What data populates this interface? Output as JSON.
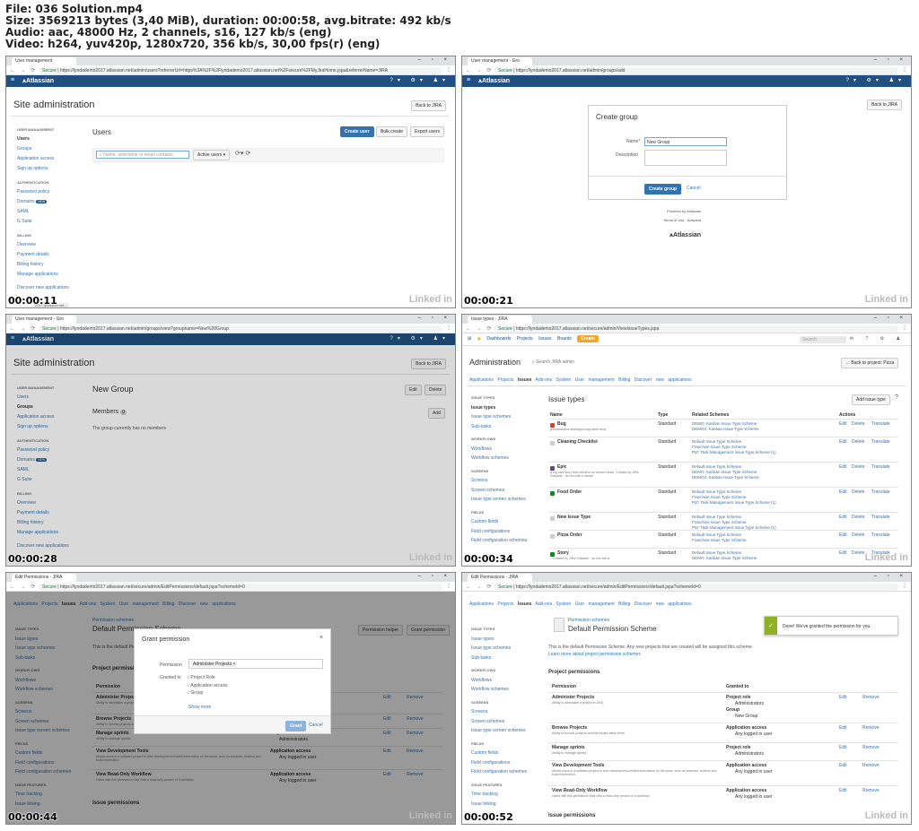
{
  "file_info": {
    "line1": "File: 036 Solution.mp4",
    "line2": "Size: 3569213 bytes (3,40 MiB), duration: 00:00:58, avg.bitrate: 492 kb/s",
    "line3": "Audio: aac, 48000 Hz, 2 channels, s16, 127 kb/s (eng)",
    "line4": "Video: h264, yuv420p, 1280x720, 356 kb/s, 30,00 fps(r) (eng)"
  },
  "watermark": "Linked in",
  "browser": {
    "secure": "Secure",
    "win_controls": "– ▫ ×"
  },
  "brand": "Atlassian",
  "frame1": {
    "tab": "User management",
    "timestamp": "00:00:11",
    "url": "https://lyndademo2017.atlassian.net/admin/users?referrerUrl=https%3A%2F%2Flyndademo2017.atlassian.net%2Fsecure%2FMyJiraHome.jspa&referrerName=JIRA",
    "title": "Site administration",
    "back": "Back to JIRA",
    "heading": "Users",
    "btn_create": "Create user",
    "btn_bulk": "Bulk create",
    "btn_export": "Export users",
    "search_ph": "Name, username or email contains",
    "filter": "Active users ▾",
    "status": "2017.atlassian.net..."
  },
  "sidebar": {
    "s1": "USER MANAGEMENT",
    "users": "Users",
    "groups": "Groups",
    "app_access": "Application access",
    "signup": "Sign up options",
    "s2": "AUTHENTICATION",
    "pw": "Password policy",
    "domains": "Domains",
    "new": "NEW",
    "saml": "SAML",
    "gsuite": "G Suite",
    "s3": "BILLING",
    "overview": "Overview",
    "payment": "Payment details",
    "billing_hist": "Billing history",
    "manage_apps": "Manage applications",
    "discover": "Discover new applications"
  },
  "frame2": {
    "tab": "User management - Gro",
    "timestamp": "00:00:21",
    "url": "https://lyndademo2017.atlassian.net/admin/groups/add",
    "title": "Create group",
    "name_label": "Name",
    "name_value": "New Group",
    "desc_label": "Description",
    "btn_create": "Create group",
    "btn_cancel": "Cancel",
    "powered": "Powered by Atlassian",
    "terms": "Terms of Use",
    "answers": "Answers",
    "back": "Back to JIRA"
  },
  "frame3": {
    "tab": "User management - Gro",
    "timestamp": "00:00:28",
    "url": "https://lyndademo2017.atlassian.net/admin/groups/view?groupname=New%20Group",
    "title": "Site administration",
    "back": "Back to JIRA",
    "group": "New Group",
    "edit": "Edit",
    "delete": "Delete",
    "members": "Members",
    "members_count": "0",
    "add": "Add",
    "empty": "The group currently has no members"
  },
  "frame4": {
    "tab": "Issue types - JIRA",
    "timestamp": "00:00:34",
    "url": "https://lyndademo2017.atlassian.net/secure/admin/ViewIssueTypes.jspa",
    "nav": [
      "Dashboards",
      "Projects",
      "Issues",
      "Boards"
    ],
    "create": "Create",
    "search": "Search",
    "title": "Administration",
    "search_admin": "Search JIRA admin",
    "back": "← Back to project: Pizza",
    "subnav": [
      "Applications",
      "Projects",
      "Issues",
      "Add-ons",
      "System",
      "User management",
      "Billing",
      "Discover new applications"
    ],
    "side": {
      "s1": "ISSUE TYPES",
      "a": "Issue types",
      "b": "Issue type schemes",
      "c": "Sub-tasks",
      "s2": "WORKFLOWS",
      "d": "Workflows",
      "e": "Workflow schemes",
      "s3": "SCREENS",
      "f": "Screens",
      "g": "Screen schemes",
      "h": "Issue type screen schemes",
      "s4": "FIELDS",
      "i": "Custom fields",
      "j": "Field configurations",
      "k": "Field configuration schemes"
    },
    "heading": "Issue types",
    "add": "Add issue type",
    "cols": {
      "name": "Name",
      "type": "Type",
      "related": "Related Schemes",
      "actions": "Actions"
    },
    "rows": [
      {
        "name": "Bug",
        "desc": "jira.translation.issuetype.bug.name.desc",
        "type": "Standard",
        "schemes": [
          "DEMO: Kanban Issue Type Scheme",
          "DEMO2: Kanban Issue Type Scheme"
        ]
      },
      {
        "name": "Cleaning Checklist",
        "desc": "",
        "type": "Standard",
        "schemes": [
          "Default Issue Type Scheme",
          "Franchise Issue Type Scheme",
          "PIZ: Task Management Issue Type Scheme (1)"
        ]
      },
      {
        "name": "Epic",
        "desc": "A big user story that needs to be broken down. Created by JIRA Software - do not edit or delete.",
        "type": "Standard",
        "schemes": [
          "Default Issue Type Scheme",
          "DEMO: Kanban Issue Type Scheme",
          "DEMO2: Kanban Issue Type Scheme"
        ]
      },
      {
        "name": "Food Order",
        "desc": "",
        "type": "Standard",
        "schemes": [
          "Default Issue Type Scheme",
          "Franchise Issue Type Scheme",
          "PIZ: Task Management Issue Type Scheme (1)"
        ]
      },
      {
        "name": "New Issue Type",
        "desc": "",
        "type": "Standard",
        "schemes": [
          "Default Issue Type Scheme",
          "Franchise Issue Type Scheme",
          "PIZ: Task Management Issue Type Scheme (1)"
        ]
      },
      {
        "name": "Pizza Order",
        "desc": "",
        "type": "Standard",
        "schemes": [
          "Default Issue Type Scheme",
          "Franchise Issue Type Scheme"
        ]
      },
      {
        "name": "Story",
        "desc": "...Created by JIRA Software - do not edit or",
        "type": "Standard",
        "schemes": [
          "Default Issue Type Scheme",
          "DEMO: Kanban Issue Type Scheme"
        ]
      }
    ],
    "act_edit": "Edit",
    "act_delete": "Delete",
    "act_translate": "Translate"
  },
  "frame5": {
    "tab": "Edit Permissions - JIRA",
    "timestamp": "00:00:44",
    "url": "https://lyndademo2017.atlassian.net/secure/admin/EditPermissions!default.jspa?schemeId=0",
    "dialog_title": "Grant permission",
    "perm_label": "Permission",
    "perm_value": "Administer Projects ×",
    "granted": "Granted to",
    "opts": [
      "Project Role",
      "Application access",
      "Group"
    ],
    "show_more": "Show more",
    "grant": "Grant",
    "cancel": "Cancel"
  },
  "frame6": {
    "tab": "Edit Permissions - JIRA",
    "timestamp": "00:00:52",
    "url": "https://lyndademo2017.atlassian.net/secure/admin/EditPermissions!default.jspa?schemeId=0",
    "crumb": "Permission schemes",
    "title": "Default Permission Scheme",
    "shared": "SHARED BY 1 PROJECTS",
    "desc": "This is the default Permission Scheme. Any new projects that are created will be assigned this scheme.",
    "learn": "Learn more about project permission schemes",
    "toast": "Done! We've granted the permission for you.",
    "section": "Project permissions",
    "col_perm": "Permission",
    "col_granted": "Granted to",
    "helper": "Permission helper",
    "grant_btn": "Grant permission",
    "rows": [
      {
        "name": "Administer Projects",
        "desc": "Ability to administer a project in JIRA.",
        "g1": "Project role",
        "v1": "Administrators",
        "g2": "Group",
        "v2": "New Group"
      },
      {
        "name": "Browse Projects",
        "desc": "Ability to browse projects and the issues within them.",
        "g1": "Application access",
        "v1": "Any logged in user"
      },
      {
        "name": "Manage sprints",
        "desc": "Ability to manage sprints.",
        "g1": "Project role",
        "v1": "Administrators"
      },
      {
        "name": "View Development Tools",
        "desc": "Allows users in a software project to view development-related information on the issue, such as commits, reviews and build information.",
        "g1": "Application access",
        "v1": "Any logged in user"
      },
      {
        "name": "View Read-Only Workflow",
        "desc": "Users with this permission may view a read-only version of a workflow.",
        "g1": "Application access",
        "v1": "Any logged in user"
      }
    ],
    "issue_perm": "Issue permissions",
    "edit": "Edit",
    "remove": "Remove",
    "side_extra": {
      "s5": "ISSUE FEATURES",
      "l": "Time tracking",
      "m": "Issue linking"
    }
  }
}
